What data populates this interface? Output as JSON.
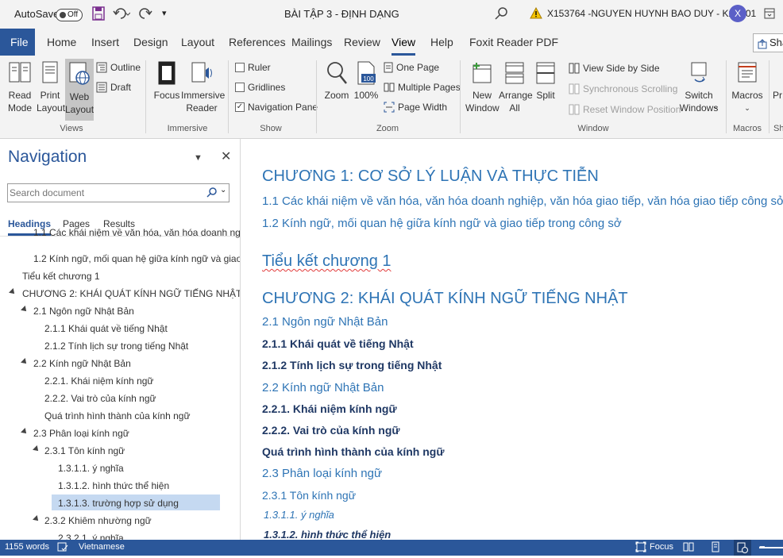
{
  "titlebar": {
    "autosave_label": "AutoSave",
    "autosave_state": "Off",
    "doc_title": "BÀI TẬP 3 - ĐỊNH DẠNG",
    "warning_text": "X153764 -NGUYEN HUYNH BAO DUY - K22S01",
    "avatar_letter": "X"
  },
  "tabs": [
    "File",
    "Home",
    "Insert",
    "Design",
    "Layout",
    "References",
    "Mailings",
    "Review",
    "View",
    "Help",
    "Foxit Reader PDF"
  ],
  "share_label": "Sha",
  "ribbon": {
    "views": {
      "read_mode": "Read\nMode",
      "print_layout": "Print\nLayout",
      "web_layout": "Web\nLayout",
      "outline": "Outline",
      "draft": "Draft",
      "group": "Views"
    },
    "immersive": {
      "focus": "Focus",
      "immersive_reader": "Immersive\nReader",
      "group": "Immersive"
    },
    "show": {
      "ruler": "Ruler",
      "gridlines": "Gridlines",
      "navigation_pane": "Navigation Pane",
      "group": "Show"
    },
    "zoom": {
      "zoom": "Zoom",
      "zoom100": "100%",
      "one_page": "One Page",
      "multiple_pages": "Multiple Pages",
      "page_width": "Page Width",
      "group": "Zoom",
      "badge": "100"
    },
    "window": {
      "new_window": "New\nWindow",
      "arrange_all": "Arrange\nAll",
      "split": "Split",
      "view_side": "View Side by Side",
      "sync_scroll": "Synchronous Scrolling",
      "reset_pos": "Reset Window Position",
      "switch_windows": "Switch\nWindows",
      "group": "Window"
    },
    "macros": {
      "macros": "Macros",
      "group": "Macros",
      "cut_label": "Pr",
      "cut_group": "Sh"
    }
  },
  "navigation": {
    "title": "Navigation",
    "search_placeholder": "Search document",
    "tabs": [
      "Headings",
      "Pages",
      "Results"
    ],
    "items": [
      {
        "text": "1.1 Các khái niệm về văn hóa, văn hóa doanh ngh...",
        "level": 2,
        "tri": false
      },
      {
        "text": "1.2 Kính ngữ, mối quan hệ giữa kính ngữ và giao...",
        "level": 2,
        "tri": false
      },
      {
        "text": "Tiểu kết chương 1",
        "level": 1,
        "tri": false
      },
      {
        "text": "CHƯƠNG 2: KHÁI QUÁT KÍNH NGỮ TIẾNG NHẬT",
        "level": 1,
        "tri": true
      },
      {
        "text": "2.1 Ngôn ngữ Nhật Bản",
        "level": 2,
        "tri": true
      },
      {
        "text": "2.1.1 Khái quát về tiếng Nhật",
        "level": 3,
        "tri": false
      },
      {
        "text": "2.1.2 Tính lịch sự trong tiếng Nhật",
        "level": 3,
        "tri": false
      },
      {
        "text": "2.2 Kính ngữ Nhật Bản",
        "level": 2,
        "tri": true
      },
      {
        "text": "2.2.1. Khái niệm kính ngữ",
        "level": 3,
        "tri": false
      },
      {
        "text": "2.2.2. Vai trò của kính ngữ",
        "level": 3,
        "tri": false
      },
      {
        "text": "Quá trình hình thành của kính ngữ",
        "level": 3,
        "tri": false
      },
      {
        "text": "2.3 Phân loại kính ngữ",
        "level": 2,
        "tri": true
      },
      {
        "text": "2.3.1 Tôn kính ngữ",
        "level": 3,
        "tri": true
      },
      {
        "text": "1.3.1.1. ý nghĩa",
        "level": 4,
        "tri": false
      },
      {
        "text": "1.3.1.2. hình thức thể hiện",
        "level": 4,
        "tri": false
      },
      {
        "text": "1.3.1.3. trường hợp sử dụng",
        "level": 4,
        "tri": false,
        "selected": true
      },
      {
        "text": "2.3.2 Khiêm nhường ngữ",
        "level": 3,
        "tri": true
      },
      {
        "text": "2.3.2.1. ý nghĩa",
        "level": 4,
        "tri": false
      }
    ]
  },
  "document": {
    "lines": [
      {
        "text": "CHƯƠNG 1: CƠ SỞ LÝ LUẬN VÀ THỰC TIỄN",
        "style": "h1"
      },
      {
        "text": "1.1 Các khái niệm về văn hóa, văn hóa doanh nghiệp, văn hóa giao tiếp, văn hóa giao tiếp công sở.",
        "style": "h2"
      },
      {
        "text": "1.2 Kính ngữ, mối quan hệ giữa kính ngữ và giao tiếp trong công sở",
        "style": "h2"
      },
      {
        "text": "Tiểu kết chương 1",
        "style": "h1"
      },
      {
        "text": "CHƯƠNG 2: KHÁI QUÁT KÍNH NGỮ TIẾNG NHẬT",
        "style": "h1"
      },
      {
        "text": "2.1 Ngôn ngữ Nhật Bản",
        "style": "h2"
      },
      {
        "text": "2.1.1 Khái quát về tiếng Nhật",
        "style": "h3"
      },
      {
        "text": "2.1.2 Tính lịch sự trong tiếng Nhật",
        "style": "h3"
      },
      {
        "text": "2.2 Kính ngữ Nhật Bản",
        "style": "h2"
      },
      {
        "text": "2.2.1. Khái niệm kính ngữ",
        "style": "h3"
      },
      {
        "text": "2.2.2. Vai trò của kính ngữ",
        "style": "h3"
      },
      {
        "text": "Quá trình hình thành của kính ngữ",
        "style": "h3"
      },
      {
        "text": "2.3 Phân loại kính ngữ",
        "style": "h2"
      },
      {
        "text": "2.3.1 Tôn kính ngữ",
        "style": "h2s"
      },
      {
        "text": "1.3.1.1. ý nghĩa",
        "style": "h4"
      },
      {
        "text": "1.3.1.2. hình thức thể hiện",
        "style": "h4b"
      }
    ]
  },
  "status": {
    "words": "1155 words",
    "language": "Vietnamese",
    "focus": "Focus"
  },
  "colors": {
    "accent": "#2b579a",
    "heading": "#2e74b5",
    "selected": "#c5d9f1"
  }
}
